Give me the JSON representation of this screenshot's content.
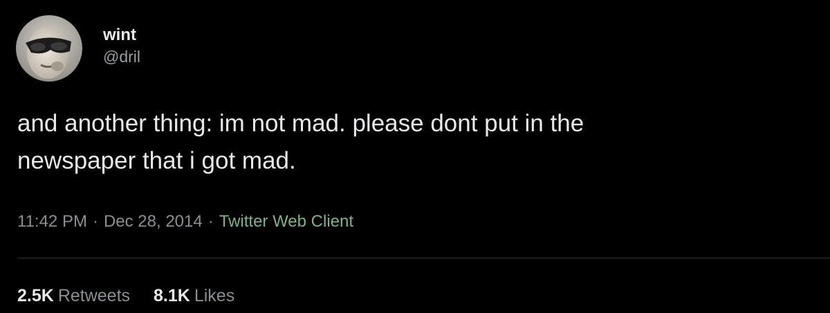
{
  "user": {
    "display_name": "wint",
    "handle": "@dril",
    "avatar_icon": "profile-photo-sunglasses"
  },
  "tweet": {
    "text_line1": "and another thing: im not mad. please dont put in the",
    "text_line2": "newspaper that i got mad.",
    "time": "11:42 PM",
    "separator": "·",
    "date": "Dec 28, 2014",
    "client": "Twitter Web Client"
  },
  "stats": {
    "retweets_count": "2.5K",
    "retweets_label": "Retweets",
    "likes_count": "8.1K",
    "likes_label": "Likes"
  },
  "colors": {
    "background": "#000000",
    "primary_text": "#e7e9ea",
    "secondary_text": "#8b8f94",
    "client_link": "#79b583",
    "divider": "#2f3336"
  }
}
